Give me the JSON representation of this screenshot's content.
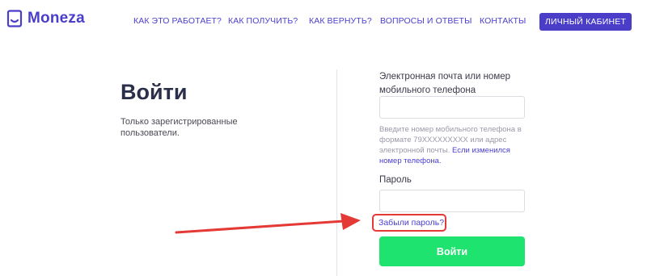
{
  "header": {
    "logo_text": "Moneza",
    "nav": [
      {
        "label": "КАК ЭТО РАБОТАЕТ?"
      },
      {
        "label": "КАК ПОЛУЧИТЬ?"
      },
      {
        "label": "КАК ВЕРНУТЬ?"
      },
      {
        "label": "ВОПРОСЫ И ОТВЕТЫ"
      },
      {
        "label": "КОНТАКТЫ"
      }
    ],
    "cabinet_button": "ЛИЧНЫЙ КАБИНЕТ"
  },
  "login": {
    "title": "Войти",
    "subtitle": "Только зарегистрированные пользователи."
  },
  "form": {
    "login_label": "Электронная почта или номер мобильного телефона",
    "login_value": "",
    "hint_text": "Введите номер мобильного телефона в формате 79XXXXXXXXX или адрес электронной почты.",
    "hint_link": "Если изменился номер телефона.",
    "password_label": "Пароль",
    "password_value": "",
    "forgot_link": "Забыли пароль?",
    "submit_label": "Войти"
  },
  "colors": {
    "brand": "#4a3ec9",
    "submit": "#1ee36e",
    "annotation": "#e53935"
  },
  "icons": {
    "logo": "moneza-logo-icon",
    "annotation_arrow": "red-arrow-icon"
  }
}
